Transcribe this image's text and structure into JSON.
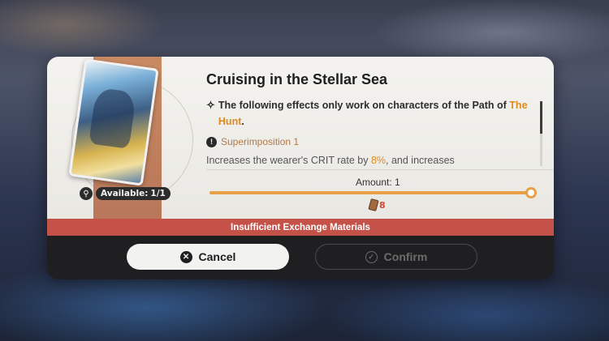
{
  "dialog": {
    "title": "Cruising in the Stellar Sea",
    "description": {
      "line1_prefix": "The following effects only work on characters of the Path of ",
      "path_name": "The Hunt",
      "line1_suffix": ".",
      "superimposition_label": "Superimposition 1",
      "effect_prefix": "Increases the wearer's CRIT rate by ",
      "effect_value": "8%",
      "effect_suffix": ", and increases"
    },
    "availability": {
      "label": "Available:",
      "value": "1/1"
    },
    "amount": {
      "label": "Amount:",
      "value": "1",
      "slider_fraction": 1.0
    },
    "cost": {
      "value": "8",
      "icon": "ticket-icon"
    },
    "warning": "Insufficient Exchange Materials",
    "buttons": {
      "cancel": "Cancel",
      "confirm": "Confirm"
    }
  },
  "icons": {
    "path": "hunt-path-icon",
    "superimposition": "info-icon",
    "search": "search-icon",
    "cancel": "x-icon",
    "confirm": "check-icon"
  },
  "colors": {
    "highlight": "#e08a1e",
    "warning_bg": "#c55249",
    "slider": "#e8a048"
  }
}
